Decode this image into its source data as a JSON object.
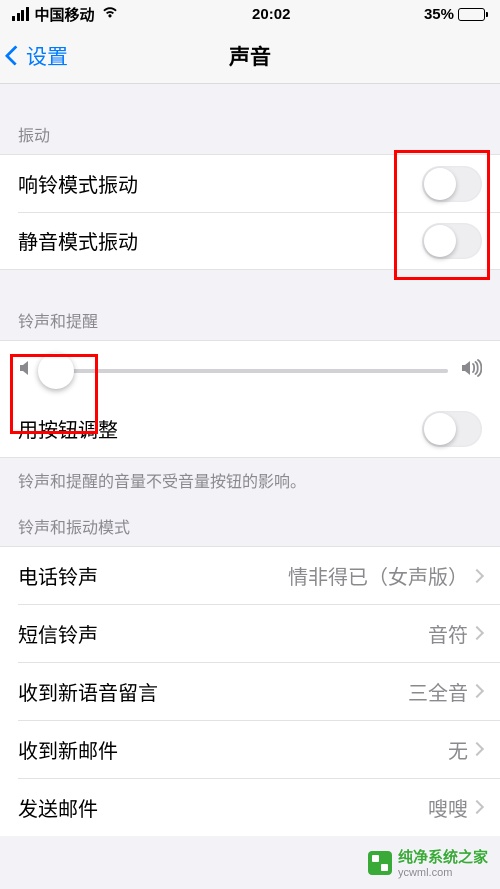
{
  "status_bar": {
    "carrier": "中国移动",
    "time": "20:02",
    "battery_text": "35%"
  },
  "nav": {
    "back_label": "设置",
    "title": "声音"
  },
  "sections": {
    "vibration": {
      "header": "振动",
      "ring_vibrate_label": "响铃模式振动",
      "silent_vibrate_label": "静音模式振动"
    },
    "ringer_alerts": {
      "header": "铃声和提醒",
      "change_with_buttons_label": "用按钮调整",
      "footer": "铃声和提醒的音量不受音量按钮的影响。"
    },
    "patterns": {
      "header": "铃声和振动模式",
      "items": [
        {
          "label": "电话铃声",
          "value": "情非得已（女声版）"
        },
        {
          "label": "短信铃声",
          "value": "音符"
        },
        {
          "label": "收到新语音留言",
          "value": "三全音"
        },
        {
          "label": "收到新邮件",
          "value": "无"
        },
        {
          "label": "发送邮件",
          "value": "嗖嗖"
        }
      ]
    }
  },
  "toggles": {
    "ring_vibrate": false,
    "silent_vibrate": false,
    "change_with_buttons": false
  },
  "slider": {
    "value": 0.05
  },
  "watermark": {
    "text": "纯净系统之家",
    "url": "ycwml.com"
  }
}
